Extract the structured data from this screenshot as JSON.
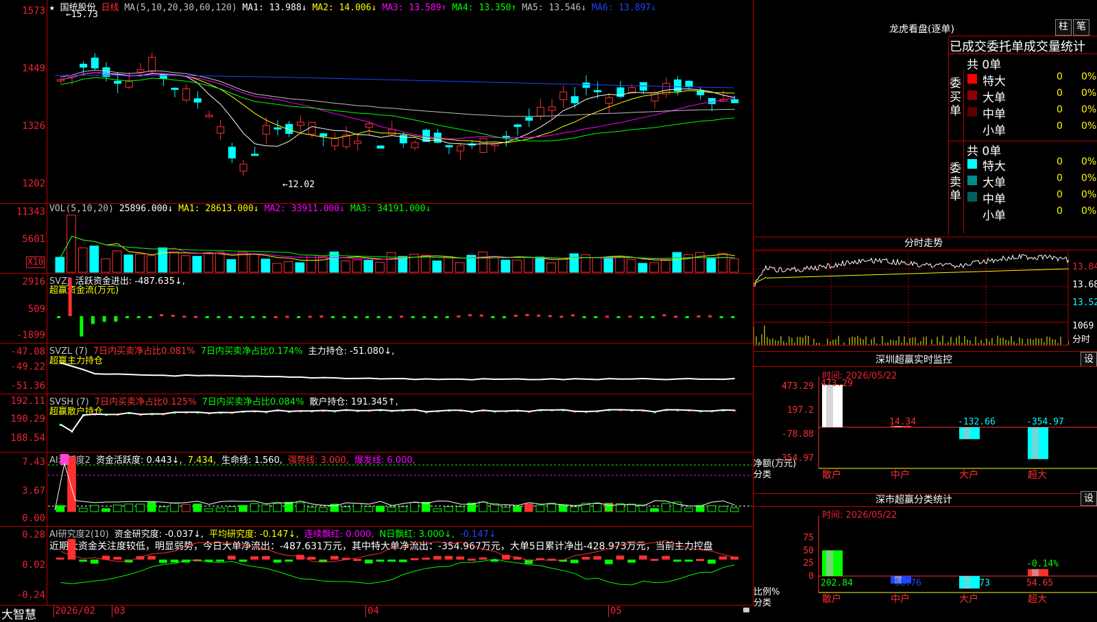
{
  "main": {
    "y_ticks": [
      "1573",
      "1449",
      "1326",
      "1202"
    ],
    "legend": {
      "star": "★",
      "stock_name": "国统股份",
      "period": "日线",
      "ma_spec": "MA(5,10,20,30,60,120)",
      "items": [
        {
          "text": "MA1: 13.988↓",
          "color": "#ffffff"
        },
        {
          "text": "MA2: 14.006↓",
          "color": "#ffff00"
        },
        {
          "text": "MA3: 13.589↑",
          "color": "#ff00ff"
        },
        {
          "text": "MA4: 13.350↑",
          "color": "#00ff00"
        },
        {
          "text": "MA5: 13.546↓",
          "color": "#c0c0c0"
        },
        {
          "text": "MA6: 13.897↓",
          "color": "#2244ff"
        }
      ]
    },
    "high_annot": "←15.73",
    "low_annot": "←12.02"
  },
  "vol": {
    "y_ticks": [
      "11343",
      "5601"
    ],
    "unit": "X10",
    "legend": [
      {
        "text": "VOL(5,10,20)",
        "color": "#c0c0c0"
      },
      {
        "text": "25896.000↓",
        "color": "#ffffff"
      },
      {
        "text": "MA1: 28613.000↓",
        "color": "#ffff00"
      },
      {
        "text": "MA2: 33911.000↓",
        "color": "#ff00ff"
      },
      {
        "text": "MA3: 34191.000↓",
        "color": "#00ff00"
      }
    ]
  },
  "svzj": {
    "y_ticks": [
      "2916",
      "509",
      "-1899"
    ],
    "legend": [
      {
        "text": "SVZJ",
        "color": "#c0c0c0"
      },
      {
        "text": "活跃资金进出: -487.635↓,",
        "color": "#ffffff"
      }
    ],
    "subtitle": "超赢资金流(万元)"
  },
  "svzl": {
    "y_ticks": [
      "-47.08",
      "-49.22",
      "-51.36"
    ],
    "legend": [
      {
        "text": "SVZL (7)",
        "color": "#c0c0c0"
      },
      {
        "text": "7日内买卖净占比0.081%",
        "color": "#ff3030"
      },
      {
        "text": "7日内买卖净占比0.174%",
        "color": "#00ff00"
      },
      {
        "text": "主力持仓: -51.080↓,",
        "color": "#ffffff"
      }
    ],
    "subtitle": "超赢主力持仓"
  },
  "svsh": {
    "y_ticks": [
      "192.11",
      "190.29",
      "188.54"
    ],
    "legend": [
      {
        "text": "SVSH (7)",
        "color": "#c0c0c0"
      },
      {
        "text": "7日内买卖净占比0.125%",
        "color": "#ff3030"
      },
      {
        "text": "7日内买卖净占比0.084%",
        "color": "#00ff00"
      },
      {
        "text": "散户持仓: 191.345↑,",
        "color": "#ffffff"
      }
    ],
    "subtitle": "超赢散户持仓"
  },
  "ai1": {
    "y_ticks": [
      "7.43",
      "3.67",
      "0.00"
    ],
    "legend": [
      {
        "text": "AI活跃度2",
        "color": "#c0c0c0"
      },
      {
        "text": "资金活跃度: 0.443↓,",
        "color": "#ffffff"
      },
      {
        "text": "7.434,",
        "color": "#ffff00"
      },
      {
        "text": "生命线: 1.560,",
        "color": "#ffffff"
      },
      {
        "text": "强势线: 3.000,",
        "color": "#ff3030"
      },
      {
        "text": "爆发线: 6.000,",
        "color": "#ff00ff"
      }
    ]
  },
  "ai2": {
    "y_ticks": [
      "0.28",
      "0.02",
      "-0.24"
    ],
    "legend": [
      {
        "text": "AI研究度2(10)",
        "color": "#c0c0c0"
      },
      {
        "text": "资金研究度: -0.037↓,",
        "color": "#ffffff"
      },
      {
        "text": "平均研究度: -0.147↓,",
        "color": "#ffff00"
      },
      {
        "text": "连续飘红: 0.000,",
        "color": "#ff00ff"
      },
      {
        "text": "N日飘红: 3.000↓,",
        "color": "#00ff00"
      },
      {
        "text": "-0.147↓",
        "color": "#2244ff"
      }
    ],
    "comment": "近期大资金关注度较低，明显弱势，今日大单净流出：-487.631万元，其中特大单净流出：-354.967万元，大单5日累计净出-428.973万元，当前主力控盘"
  },
  "xaxis": {
    "brand": "大智慧",
    "labels": [
      "2026/02",
      "03",
      "04",
      "05"
    ]
  },
  "right": {
    "title": "龙虎看盘(逐单)",
    "btn_zhu": "柱",
    "btn_bi": "笔",
    "stats_header": "已成交委托单成交量统计",
    "buy_label": "委买单",
    "sell_label": "委卖单",
    "buy": {
      "total": "共 0单",
      "rows": [
        {
          "name": "特大",
          "val": "0",
          "pct": "0%",
          "color": "#ff0000"
        },
        {
          "name": "大单",
          "val": "0",
          "pct": "0%",
          "color": "#8b0000"
        },
        {
          "name": "中单",
          "val": "0",
          "pct": "0%",
          "color": "#5a0000"
        },
        {
          "name": "小单",
          "val": "0",
          "pct": "0%",
          "color": ""
        }
      ]
    },
    "sell": {
      "total": "共 0单",
      "rows": [
        {
          "name": "特大",
          "val": "0",
          "pct": "0%",
          "color": "#00ffff"
        },
        {
          "name": "大单",
          "val": "0",
          "pct": "0%",
          "color": "#008b8b"
        },
        {
          "name": "中单",
          "val": "0",
          "pct": "0%",
          "color": "#006060"
        },
        {
          "name": "小单",
          "val": "0",
          "pct": "0%",
          "color": ""
        }
      ]
    },
    "intraday": {
      "title": "分时走势",
      "ticks": [
        "13.84",
        "13.68",
        "13.52",
        "1069"
      ],
      "vol_unit": "分时"
    },
    "monitor": {
      "title": "深圳超赢实时监控",
      "btn": "设",
      "time": "时间: 2026/05/22",
      "y_ticks": [
        "473.29",
        "197.2",
        "-78.88",
        "-354.97"
      ],
      "ylabel": "净额(万元)",
      "xlabel": "分类",
      "bars": [
        {
          "cat": "散户",
          "value": 473.29,
          "label": "473.29",
          "color": "#ffffff",
          "label_color": "#ff3030",
          "cat_color": "#ff3030"
        },
        {
          "cat": "中户",
          "value": 14.34,
          "label": "14.34",
          "color": "#ff4040",
          "label_color": "#ff3030",
          "cat_color": "#ff3030"
        },
        {
          "cat": "大户",
          "value": -132.66,
          "label": "-132.66",
          "color": "#00ffff",
          "label_color": "#00ffff",
          "cat_color": "#ff3030"
        },
        {
          "cat": "超大",
          "value": -354.97,
          "label": "-354.97",
          "color": "#00ffff",
          "label_color": "#00ffff",
          "cat_color": "#ff3030"
        }
      ]
    },
    "classify": {
      "title": "深市超赢分类统计",
      "btn": "设",
      "time": "时间: 2026/05/22",
      "y_ticks": [
        "75",
        "50",
        "25",
        "0"
      ],
      "ylabel": "比例%",
      "xlabel": "分类",
      "bars": [
        {
          "cat": "散户",
          "value": 202.84,
          "label": "202.84",
          "color": "#00ff00",
          "cat_color": "#ff3030",
          "label_color": "#00ff00"
        },
        {
          "cat": "中户",
          "value": -58.76,
          "label": "-58.76",
          "color": "#2244ff",
          "cat_color": "#ff3030",
          "label_color": "#2244ff"
        },
        {
          "cat": "大户",
          "value": -98.73,
          "label": "-98.73",
          "color": "#00ffff",
          "cat_color": "#ff3030",
          "label_color": "#00ffff"
        },
        {
          "cat": "超大",
          "value": 54.65,
          "label": "54.65",
          "color": "#ff3030",
          "cat_color": "#ff3030",
          "label_color": "#ff3030",
          "top_label": "-0.14%"
        }
      ]
    }
  }
}
